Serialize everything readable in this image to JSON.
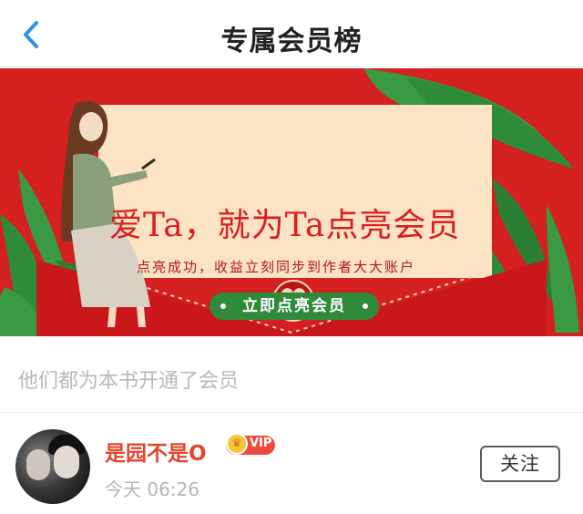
{
  "header": {
    "title": "专属会员榜",
    "back_icon": "chevron-left-icon"
  },
  "banner": {
    "headline": "爱Ta，就为Ta点亮会员",
    "subline": "点亮成功，收益立刻同步到作者大大账户",
    "button_label": "立即点亮会员",
    "icon": "heart-seal-icon"
  },
  "section": {
    "label": "他们都为本书开通了会员"
  },
  "members": [
    {
      "name": "是园不是O",
      "badge": "VIP",
      "time": "今天 06:26",
      "follow_label": "关注"
    }
  ],
  "colors": {
    "banner_red": "#d4201e",
    "accent_green": "#2f8a3a",
    "name_red": "#e2472e",
    "back_blue": "#2f93e0"
  }
}
